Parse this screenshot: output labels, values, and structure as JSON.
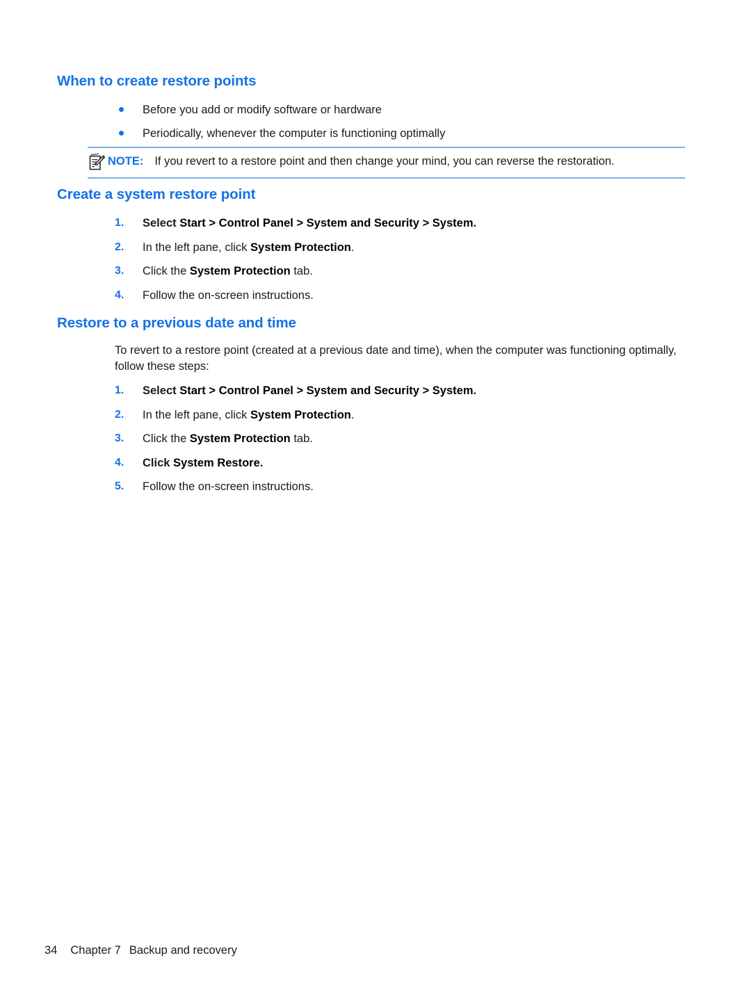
{
  "document": {
    "sections": [
      {
        "heading": "When to create restore points",
        "bullets": [
          "Before you add or modify software or hardware",
          "Periodically, whenever the computer is functioning optimally"
        ],
        "note": {
          "icon": "note-pencil-icon",
          "label": "NOTE:",
          "text": "If you revert to a restore point and then change your mind, you can reverse the restoration."
        }
      },
      {
        "heading": "Create a system restore point",
        "steps": [
          {
            "number": "1.",
            "pre": "Select ",
            "bold": "Start > Control Panel > System and Security > System",
            "post": "."
          },
          {
            "number": "2.",
            "pre": "In the left pane, click ",
            "bold": "System Protection",
            "post": "."
          },
          {
            "number": "3.",
            "pre": "Click the ",
            "bold": "System Protection",
            "post": " tab."
          },
          {
            "number": "4.",
            "pre": "Follow the on-screen instructions.",
            "bold": "",
            "post": ""
          }
        ]
      },
      {
        "heading": "Restore to a previous date and time",
        "paragraph": "To revert to a restore point (created at a previous date and time), when the computer was functioning optimally, follow these steps:",
        "steps": [
          {
            "number": "1.",
            "pre": "Select ",
            "bold": "Start > Control Panel > System and Security > System",
            "post": "."
          },
          {
            "number": "2.",
            "pre": "In the left pane, click ",
            "bold": "System Protection",
            "post": "."
          },
          {
            "number": "3.",
            "pre": "Click the ",
            "bold": "System Protection",
            "post": " tab."
          },
          {
            "number": "4.",
            "pre": "Click ",
            "bold": "System Restore",
            "post": "."
          },
          {
            "number": "5.",
            "pre": "Follow the on-screen instructions.",
            "bold": "",
            "post": ""
          }
        ]
      }
    ],
    "footer": {
      "page_number": "34",
      "chapter": "Chapter 7",
      "chapter_title": "Backup and recovery"
    },
    "colors": {
      "heading_blue": "#1472e6",
      "rule_blue": "#7aadea",
      "body_text": "#1a1a1a"
    }
  }
}
